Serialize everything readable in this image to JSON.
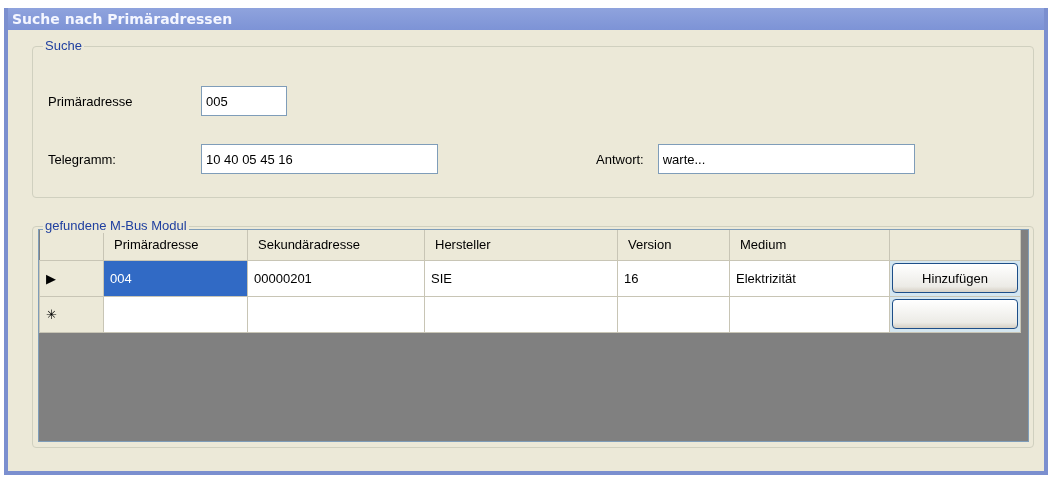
{
  "window": {
    "title": "Suche nach Primäradressen"
  },
  "search_group": {
    "legend": "Suche",
    "fields": [
      {
        "label": "Primäradresse",
        "value": "005"
      },
      {
        "label": "Telegramm:",
        "value": "10 40 05 45 16"
      },
      {
        "label": "Antwort:",
        "value": "warte..."
      }
    ]
  },
  "results_group": {
    "legend": "gefundene M-Bus Modul",
    "table": {
      "columns": [
        "Primäradresse",
        "Sekundäradresse",
        "Hersteller",
        "Version",
        "Medium"
      ],
      "rows": [
        {
          "indicator": "▶",
          "selected": true,
          "cells": [
            "004",
            "00000201",
            "SIE",
            "16",
            "Elektrizität"
          ],
          "button": "Hinzufügen"
        },
        {
          "indicator": "✳",
          "selected": false
        }
      ]
    }
  }
}
